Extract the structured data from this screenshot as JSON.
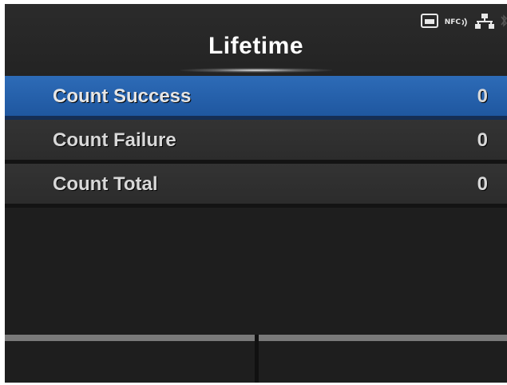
{
  "header": {
    "title": "Lifetime",
    "status_icons": {
      "sd_card": "sd-card-icon",
      "nfc": "NFC",
      "network": "network-icon",
      "bluetooth": "bluetooth-icon"
    }
  },
  "list": {
    "items": [
      {
        "label": "Count Success",
        "value": "0",
        "selected": true
      },
      {
        "label": "Count Failure",
        "value": "0",
        "selected": false
      },
      {
        "label": "Count Total",
        "value": "0",
        "selected": false
      }
    ]
  },
  "softkeys": {
    "left": "",
    "right": ""
  },
  "colors": {
    "background": "#1e1e1e",
    "selected_row": "#2562ac",
    "row": "#303030",
    "text": "#d8d8d8"
  }
}
